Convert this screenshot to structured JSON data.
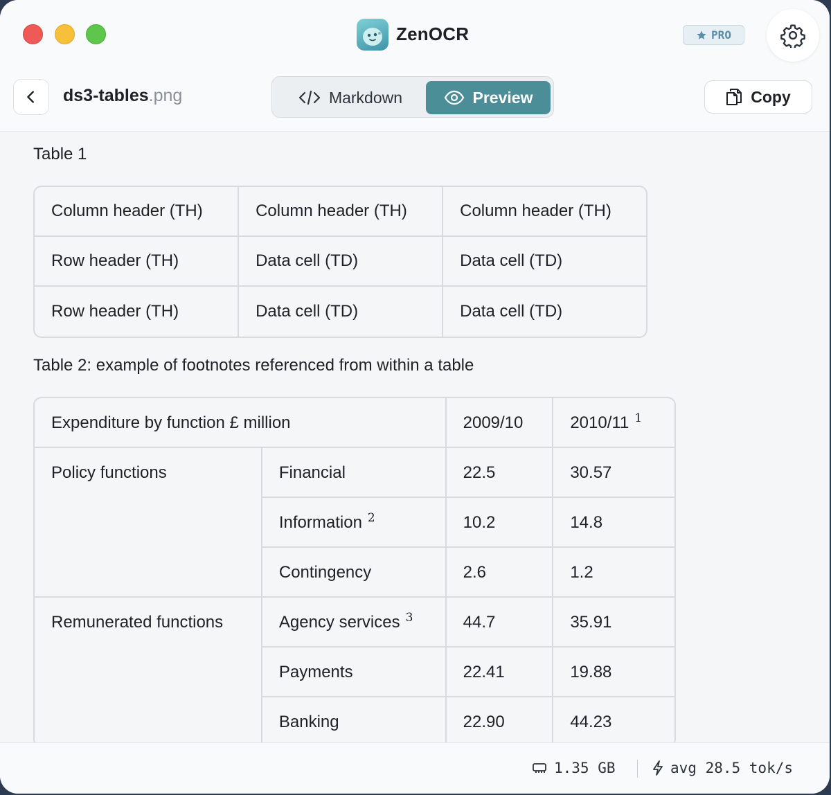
{
  "app": {
    "title": "ZenOCR",
    "badge": "PRO"
  },
  "file": {
    "name": "ds3-tables",
    "ext": ".png"
  },
  "view_toggle": {
    "markdown_label": "Markdown",
    "preview_label": "Preview",
    "selected": "Preview"
  },
  "toolbar": {
    "copy_label": "Copy"
  },
  "colors": {
    "accent": "#4b8e98",
    "traffic_red": "#ee5b56",
    "traffic_yellow": "#f6c03b",
    "traffic_green": "#5ec64c"
  },
  "icons": [
    "chevron-left-icon",
    "code-icon",
    "eye-icon",
    "copy-icon",
    "gear-icon",
    "star-icon",
    "memory-icon",
    "bolt-icon"
  ],
  "table1": {
    "caption": "Table 1",
    "rows": [
      [
        "Column header (TH)",
        "Column header (TH)",
        "Column header (TH)"
      ],
      [
        "Row header (TH)",
        "Data cell (TD)",
        "Data cell (TD)"
      ],
      [
        "Row header (TH)",
        "Data cell (TD)",
        "Data cell (TD)"
      ]
    ]
  },
  "table2": {
    "caption": "Table 2: example of footnotes referenced from within a table",
    "header": {
      "label": "Expenditure by function £ million",
      "col1": "2009/10",
      "col2": "2010/11",
      "col2_note": "1"
    },
    "groups": [
      {
        "name": "Policy functions",
        "rows": [
          {
            "item": "Financial",
            "note": "",
            "v1": "22.5",
            "v2": "30.57"
          },
          {
            "item": "Information",
            "note": "2",
            "v1": "10.2",
            "v2": "14.8"
          },
          {
            "item": "Contingency",
            "note": "",
            "v1": "2.6",
            "v2": "1.2"
          }
        ]
      },
      {
        "name": "Remunerated functions",
        "rows": [
          {
            "item": "Agency services",
            "note": "3",
            "v1": "44.7",
            "v2": "35.91"
          },
          {
            "item": "Payments",
            "note": "",
            "v1": "22.41",
            "v2": "19.88"
          },
          {
            "item": "Banking",
            "note": "",
            "v1": "22.90",
            "v2": "44.23"
          }
        ]
      }
    ]
  },
  "status": {
    "memory": "1.35 GB",
    "speed": "avg 28.5 tok/s"
  }
}
